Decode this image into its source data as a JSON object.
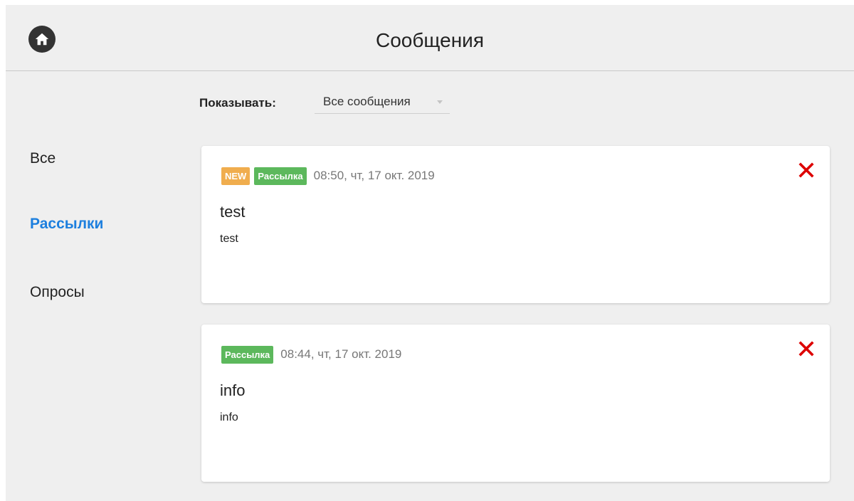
{
  "header": {
    "title": "Сообщения",
    "home_icon": "home-icon"
  },
  "filter": {
    "label": "Показывать:",
    "selected": "Все сообщения"
  },
  "sidebar": {
    "items": [
      {
        "label": "Все",
        "active": false
      },
      {
        "label": "Рассылки",
        "active": true
      },
      {
        "label": "Опросы",
        "active": false
      }
    ]
  },
  "messages": [
    {
      "new_badge": "NEW",
      "type_badge": "Рассылка",
      "date": "08:50, чт, 17 окт. 2019",
      "title": "test",
      "body": "test"
    },
    {
      "type_badge": "Рассылка",
      "date": "08:44, чт, 17 окт. 2019",
      "title": "info",
      "body": "info"
    }
  ],
  "colors": {
    "accent": "#1d7fde",
    "new_badge": "#f0ad4e",
    "type_badge": "#5cb85c",
    "delete": "#dd0000"
  }
}
